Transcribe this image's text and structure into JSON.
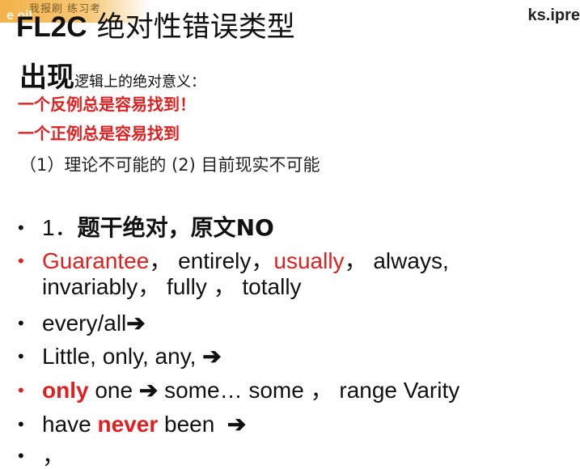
{
  "header": {
    "logo_cn": "我报刷 练习考",
    "logo_en": "e  oil",
    "url_fragment": "ks.ipre"
  },
  "title": {
    "latin": "FL2C",
    "cn": "绝对性错误类型"
  },
  "subtitle": {
    "big": "出现",
    "small": "逻辑上的绝对意义："
  },
  "red_lines": [
    "一个反例总是容易找到！",
    "一个正例总是容易找到"
  ],
  "note": "（1）理论不可能的 (2) 目前现实不可能",
  "bullets": {
    "b1": {
      "num": "1．",
      "text": "题干绝对，原文NO"
    },
    "b2": {
      "w1": "Guarantee",
      "s1": "，",
      "w2": "entirely，",
      "w3": "usually",
      "s2": "，",
      "w4": "always,",
      "line2": "invariably， fully ， totally"
    },
    "b3": {
      "text": "every/all",
      "arrow": "➔"
    },
    "b4": {
      "text": "Little, only, any,",
      "arrow": "➔"
    },
    "b5": {
      "w1": "only",
      "w2": "one",
      "arrow": "➔",
      "rest": "some… some ， range Varity"
    },
    "b6": {
      "w1": "have",
      "w2": "never",
      "w3": "been",
      "arrow": "➔"
    },
    "b7": {
      "text": "，"
    }
  },
  "colors": {
    "accent_red": "#e02020",
    "text": "#111111",
    "logo_band": "#f3b24a"
  }
}
